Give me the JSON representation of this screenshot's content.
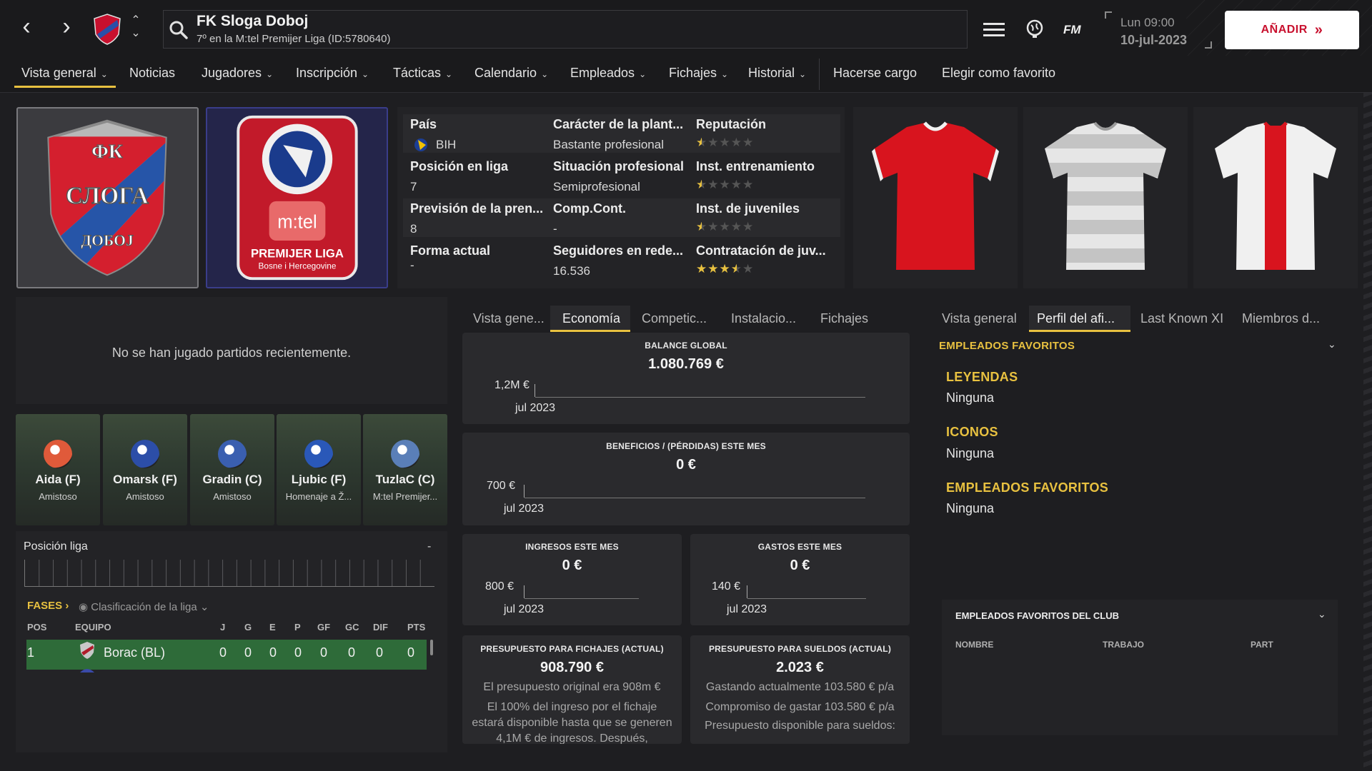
{
  "header": {
    "club_name": "FK Sloga Doboj",
    "club_subtitle": "7º en la M:tel Premijer Liga (ID:5780640)",
    "fm_logo": "FM",
    "date_day": "Lun 09:00",
    "date": "10-jul-2023",
    "add_button": "AÑADIR"
  },
  "nav": {
    "tabs": [
      "Vista general",
      "Noticias",
      "Jugadores",
      "Inscripción",
      "Tácticas",
      "Calendario",
      "Empleados",
      "Fichajes",
      "Historial"
    ],
    "actions": [
      "Hacerse cargo",
      "Elegir como favorito"
    ]
  },
  "crest": {
    "top": "ФК",
    "middle": "СЛОГА",
    "bottom": "ДОБОЈ"
  },
  "league_badge": {
    "brand": "m:tel",
    "line1": "PREMIJER LIGA",
    "line2": "Bosne i Hercegovine"
  },
  "info": {
    "country_label": "País",
    "country_value": "BIH",
    "squad_char_label": "Carácter de la plant...",
    "squad_char_value": "Bastante profesional",
    "reputation_label": "Reputación",
    "reputation_stars": 0.5,
    "league_pos_label": "Posición en liga",
    "league_pos_value": "7",
    "prof_status_label": "Situación profesional",
    "prof_status_value": "Semiprofesional",
    "training_label": "Inst. entrenamiento",
    "training_stars": 0.5,
    "press_label": "Previsión de la pren...",
    "press_value": "8",
    "comp_label": "Comp.Cont.",
    "comp_value": "-",
    "youth_label": "Inst. de juveniles",
    "youth_stars": 0.5,
    "form_label": "Forma actual",
    "form_value": "-",
    "followers_label": "Seguidores en rede...",
    "followers_value": "16.536",
    "youth_recruit_label": "Contratación de juv...",
    "youth_recruit_stars": 3.5
  },
  "recent": {
    "message": "No se han jugado partidos recientemente."
  },
  "fixtures": [
    {
      "team": "Aida (F)",
      "comp": "Amistoso",
      "color": "#e05a3a"
    },
    {
      "team": "Omarsk (F)",
      "comp": "Amistoso",
      "color": "#2c4ea8"
    },
    {
      "team": "Gradin (C)",
      "comp": "Amistoso",
      "color": "#3a5fb0"
    },
    {
      "team": "Ljubic (F)",
      "comp": "Homenaje a Ž...",
      "color": "#2a58b8"
    },
    {
      "team": "TuzlaC (C)",
      "comp": "M:tel Premijer...",
      "color": "#5a7fb8"
    }
  ],
  "league": {
    "position_label": "Posición liga",
    "position_value": "-",
    "fases": "FASES",
    "classification": "Clasificación de la liga",
    "headers": [
      "POS",
      "EQUIPO",
      "J",
      "G",
      "E",
      "P",
      "GF",
      "GC",
      "DIF",
      "PTS"
    ],
    "row": {
      "pos": "1",
      "team": "Borac (BL)",
      "j": "0",
      "g": "0",
      "e": "0",
      "p": "0",
      "gf": "0",
      "gc": "0",
      "dif": "0",
      "pts": "0"
    }
  },
  "mid_tabs": [
    "Vista gene...",
    "Economía",
    "Competic...",
    "Instalacio...",
    "Fichajes"
  ],
  "finance": {
    "balance_title": "BALANCE GLOBAL",
    "balance_value": "1.080.769 €",
    "balance_axis": "1,2M €",
    "balance_month": "jul 2023",
    "profit_title": "BENEFICIOS / (PÉRDIDAS) ESTE MES",
    "profit_value": "0 €",
    "profit_axis": "700 €",
    "profit_month": "jul 2023",
    "income_title": "INGRESOS ESTE MES",
    "income_value": "0 €",
    "income_axis": "800 €",
    "income_month": "jul 2023",
    "expenses_title": "GASTOS ESTE MES",
    "expenses_value": "0 €",
    "expenses_axis": "140 €",
    "expenses_month": "jul 2023",
    "transfer_title": "PRESUPUESTO PARA FICHAJES (ACTUAL)",
    "transfer_value": "908.790 €",
    "transfer_note1": "El presupuesto original era 908m €",
    "transfer_note2": "El 100% del ingreso por el fichaje estará disponible hasta que se generen 4,1M € de ingresos. Después,",
    "wage_title": "PRESUPUESTO PARA SUELDOS (ACTUAL)",
    "wage_value": "2.023 €",
    "wage_note1": "Gastando actualmente 103.580 € p/a",
    "wage_note2": "Compromiso de gastar 103.580 € p/a",
    "wage_note3": "Presupuesto disponible para sueldos:"
  },
  "right_tabs": [
    "Vista general",
    "Perfil del afi...",
    "Last Known XI",
    "Miembros d..."
  ],
  "favourites": {
    "section_title": "EMPLEADOS FAVORITOS",
    "legends_title": "LEYENDAS",
    "legends_value": "Ninguna",
    "icons_title": "ICONOS",
    "icons_value": "Ninguna",
    "fav_title": "EMPLEADOS FAVORITOS",
    "fav_value": "Ninguna",
    "club_fav_title": "EMPLEADOS FAVORITOS DEL CLUB",
    "col_name": "NOMBRE",
    "col_job": "TRABAJO",
    "col_part": "PART"
  },
  "colors": {
    "accent": "#e8c140",
    "table_highlight": "#2e6b39",
    "add_text": "#c8102e"
  }
}
